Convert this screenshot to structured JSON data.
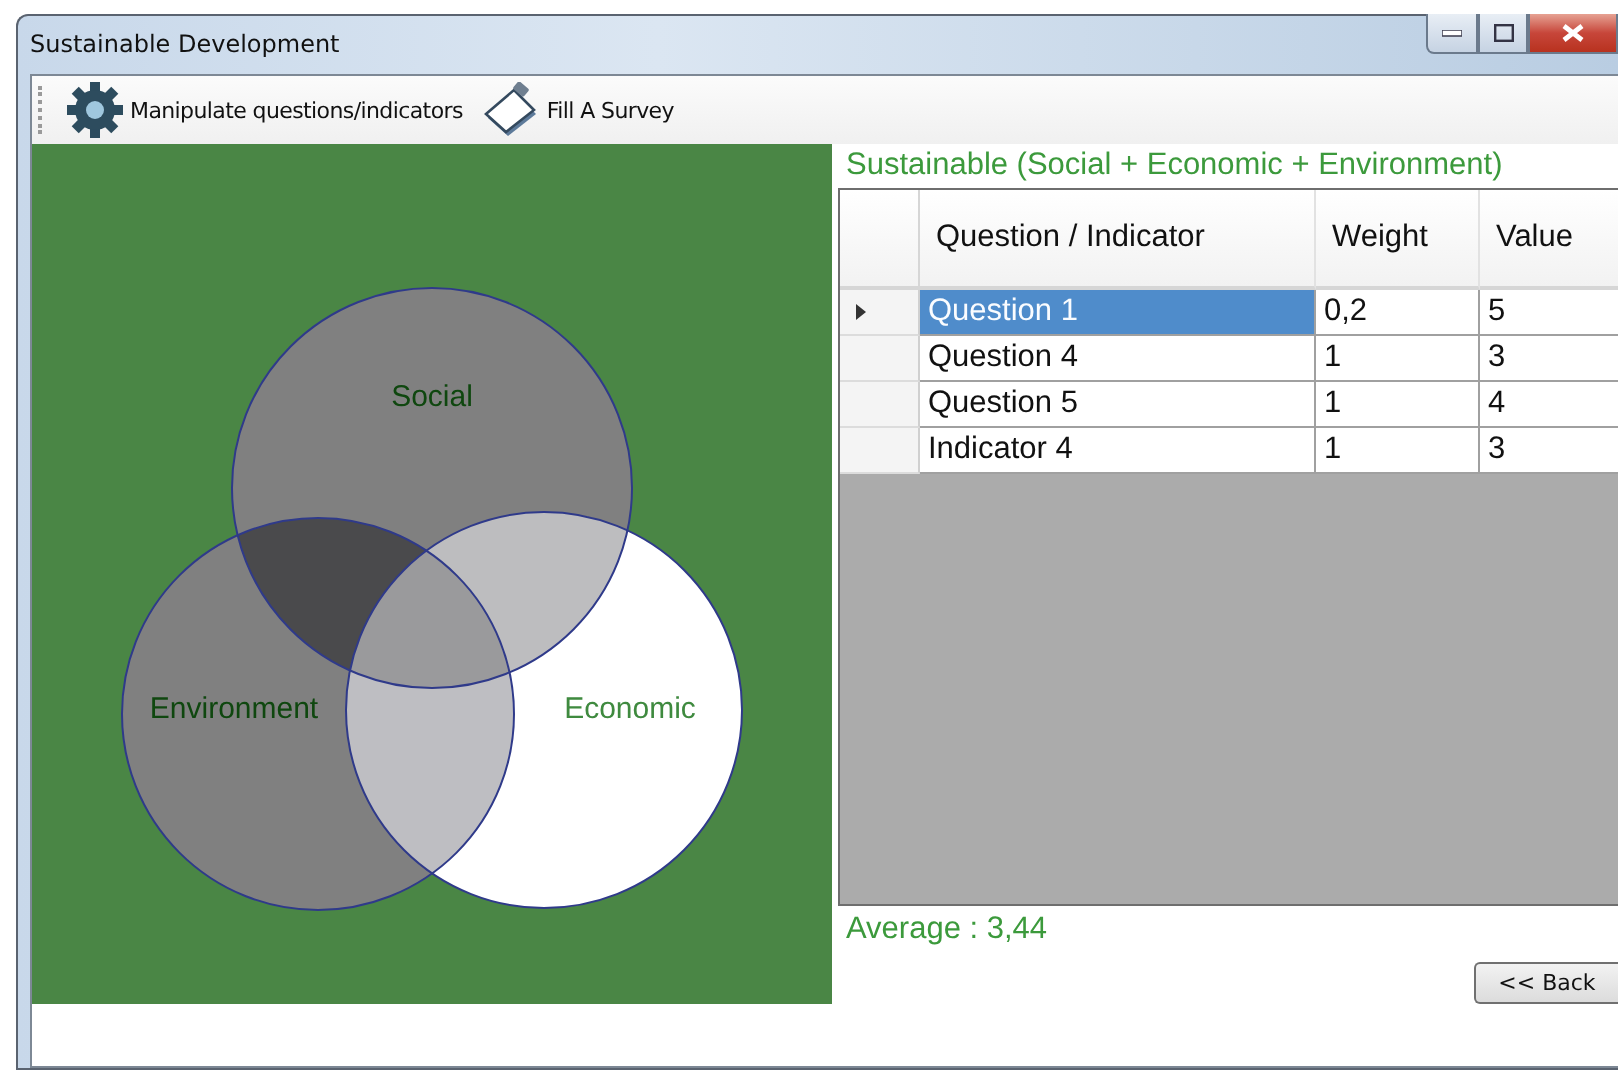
{
  "window": {
    "title": "Sustainable Development"
  },
  "toolbar": [
    {
      "label": "Manipulate questions/indicators",
      "kind": "gear"
    },
    {
      "label": "Fill A Survey",
      "kind": "clipboard"
    }
  ],
  "venn": {
    "sets": [
      {
        "label": "Social"
      },
      {
        "label": "Environment"
      },
      {
        "label": "Economic"
      }
    ]
  },
  "grid": {
    "title": "Sustainable (Social + Economic + Environment)",
    "columns": [
      "Question / Indicator",
      "Weight",
      "Value"
    ],
    "rows": [
      {
        "cells": [
          "Question 1",
          "0,2",
          "5"
        ],
        "selected": true
      },
      {
        "cells": [
          "Question 4",
          "1",
          "3"
        ],
        "selected": false
      },
      {
        "cells": [
          "Question 5",
          "1",
          "4"
        ],
        "selected": false
      },
      {
        "cells": [
          "Indicator 4",
          "1",
          "3"
        ],
        "selected": false
      }
    ]
  },
  "average": "Average : 3,44",
  "back_button": "<< Back"
}
